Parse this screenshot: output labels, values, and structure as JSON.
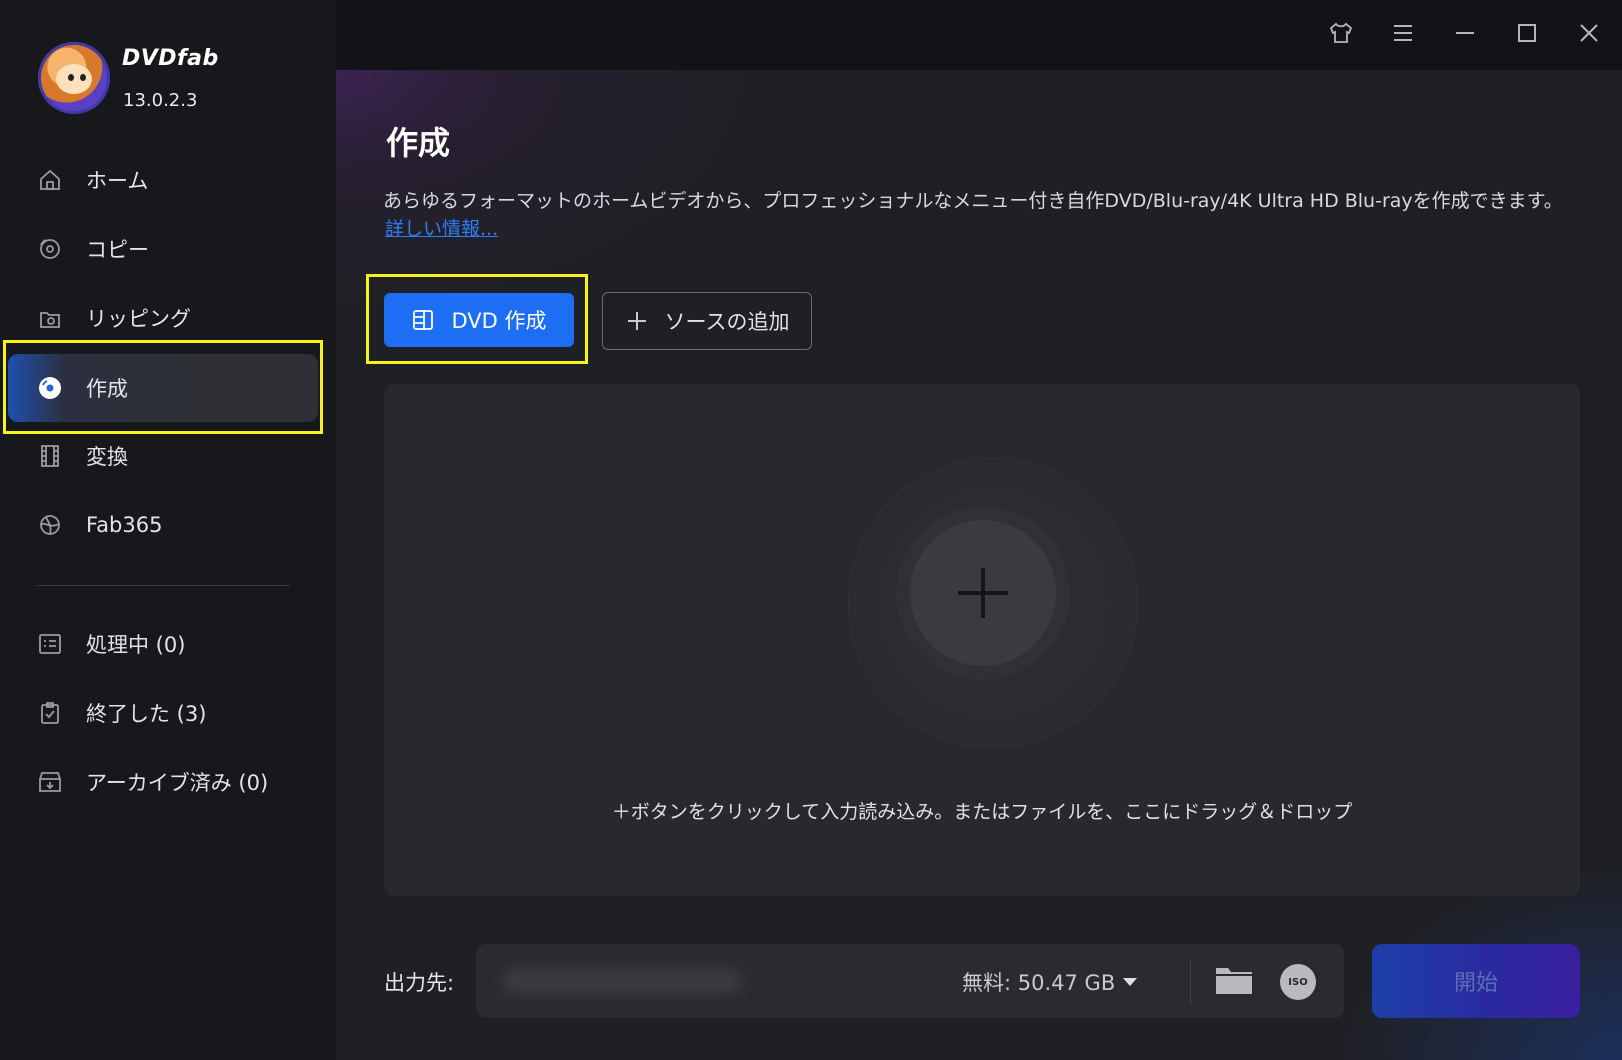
{
  "app": {
    "brand": "DVDfab",
    "version": "13.0.2.3"
  },
  "sidebar": {
    "items": [
      {
        "label": "ホーム",
        "icon": "home-icon"
      },
      {
        "label": "コピー",
        "icon": "copy-disc-icon"
      },
      {
        "label": "リッピング",
        "icon": "ripping-icon"
      },
      {
        "label": "作成",
        "icon": "creator-disc-icon",
        "active": true
      },
      {
        "label": "変換",
        "icon": "film-icon"
      },
      {
        "label": "Fab365",
        "icon": "fab365-icon"
      }
    ],
    "tasks": [
      {
        "label": "処理中 (0)",
        "icon": "processing-list-icon"
      },
      {
        "label": "終了した (3)",
        "icon": "finished-clipboard-icon"
      },
      {
        "label": "アーカイブ済み (0)",
        "icon": "archive-box-icon"
      }
    ]
  },
  "window_controls": [
    "skin-shirt-icon",
    "menu-icon",
    "minimize-icon",
    "maximize-icon",
    "close-icon"
  ],
  "main": {
    "title": "作成",
    "description": "あらゆるフォーマットのホームビデオから、プロフェッショナルなメニュー付き自作DVD/Blu-ray/4K Ultra HD Blu-rayを作成できます。",
    "more_link": "詳しい情報...",
    "primary_button": "DVD 作成",
    "add_source_button": "ソースの追加",
    "drop_hint": "＋ボタンをクリックして入力読み込み。またはファイルを、ここにドラッグ＆ドロップ"
  },
  "output": {
    "label": "出力先:",
    "free_space": "無料:  50.47 GB",
    "iso_label": "ISO",
    "start_button": "開始"
  },
  "colors": {
    "accent": "#1e6ef5",
    "highlight": "#f6f21a",
    "link": "#2e7cf6"
  }
}
